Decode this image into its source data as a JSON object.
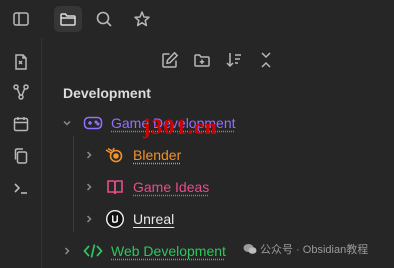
{
  "top_tabs": [
    {
      "icon": "sidebar-toggle-icon"
    },
    {
      "icon": "folder-icon",
      "active": true
    },
    {
      "icon": "search-icon"
    },
    {
      "icon": "star-icon"
    }
  ],
  "ribbon": [
    "open-quick-switcher-icon",
    "graph-view-icon",
    "calendar-icon",
    "copy-icon",
    "terminal-icon"
  ],
  "nav_actions": [
    "new-note-icon",
    "new-folder-icon",
    "sort-icon",
    "collapse-all-icon"
  ],
  "vault_name": "Development",
  "tree": {
    "game": {
      "label": "Game Development",
      "color": "#9370ff"
    },
    "blender": {
      "label": "Blender",
      "color": "#f0922e"
    },
    "ideas": {
      "label": "Game Ideas",
      "color": "#e84d8a"
    },
    "unreal": {
      "label": "Unreal",
      "color": "#e8e8e8"
    },
    "web": {
      "label": "Web Development",
      "color": "#2dc75e"
    }
  },
  "watermark": {
    "channel": "公众号 · Obsidian教程",
    "overlay": "j301.cn"
  }
}
